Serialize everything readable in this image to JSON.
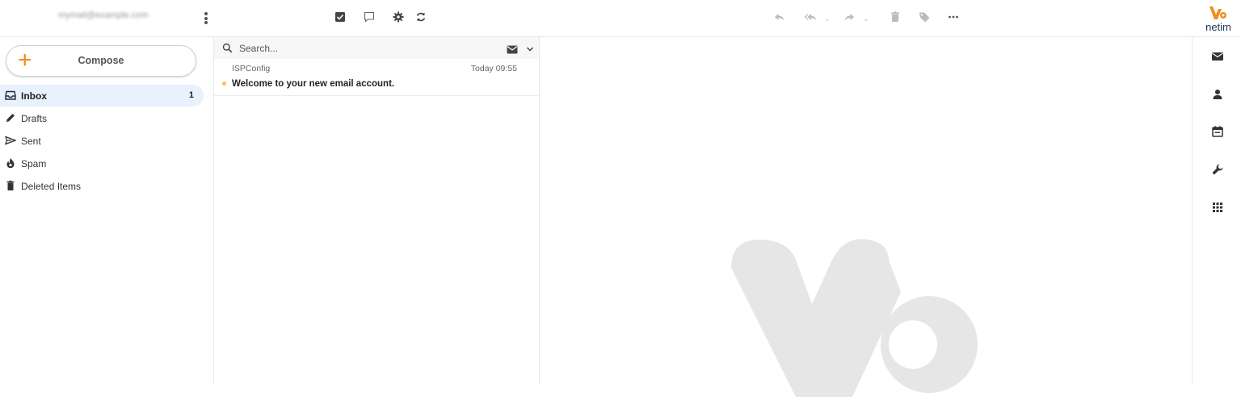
{
  "header": {
    "account": "mymail@example.com",
    "logo_text": "netim"
  },
  "toolbar": {
    "left_icons": [
      "select-icon",
      "thread-icon",
      "settings-icon",
      "refresh-icon"
    ],
    "message_icons": [
      "reply-icon",
      "reply-all-icon",
      "forward-icon",
      "delete-icon",
      "tag-icon",
      "more-icon"
    ]
  },
  "compose": {
    "label": "Compose"
  },
  "folders": [
    {
      "label": "Inbox",
      "count": "1",
      "icon": "inbox-icon",
      "active": true
    },
    {
      "label": "Drafts",
      "count": "",
      "icon": "pencil-icon"
    },
    {
      "label": "Sent",
      "count": "",
      "icon": "send-icon"
    },
    {
      "label": "Spam",
      "count": "",
      "icon": "fire-icon"
    },
    {
      "label": "Deleted Items",
      "count": "",
      "icon": "trash-icon"
    }
  ],
  "search": {
    "placeholder": "Search..."
  },
  "messages": [
    {
      "from": "ISPConfig",
      "date": "Today 09:55",
      "subject": "Welcome to your new email account.",
      "unread": true
    }
  ],
  "rail": [
    "mail-icon",
    "contacts-icon",
    "calendar-icon",
    "wrench-icon",
    "apps-icon"
  ],
  "colors": {
    "accent": "#f28c1e",
    "active_bg": "#e8f1fc",
    "unread_dot": "#f5c34a",
    "watermark": "#e6e6e6"
  }
}
